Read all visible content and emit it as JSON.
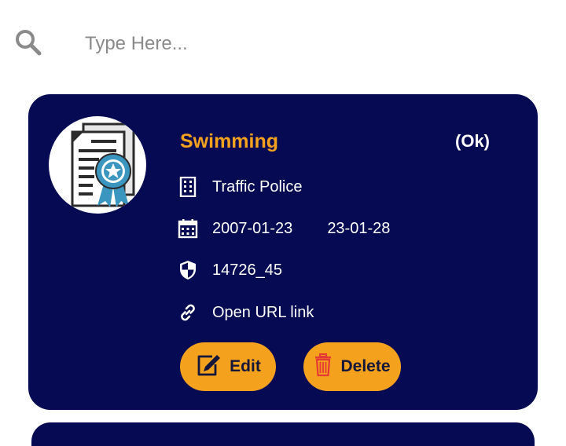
{
  "search": {
    "placeholder": "Type Here..."
  },
  "card": {
    "title": "Swimming",
    "status": "(Ok)",
    "organization": "Traffic Police",
    "start_date": "2007-01-23",
    "end_date": "23-01-28",
    "id": "14726_45",
    "link_text": "Open URL link",
    "edit_label": "Edit",
    "delete_label": "Delete"
  },
  "colors": {
    "card_background": "#050a52",
    "accent": "#f4a21e",
    "delete_icon": "#e53935",
    "certificate_ribbon": "#3a95bf"
  },
  "icons": {
    "search": "search-icon",
    "avatar": "certificate-icon",
    "organization": "building-icon",
    "date": "calendar-icon",
    "id": "shield-icon",
    "link": "link-icon",
    "edit": "edit-icon",
    "delete": "trash-icon"
  }
}
